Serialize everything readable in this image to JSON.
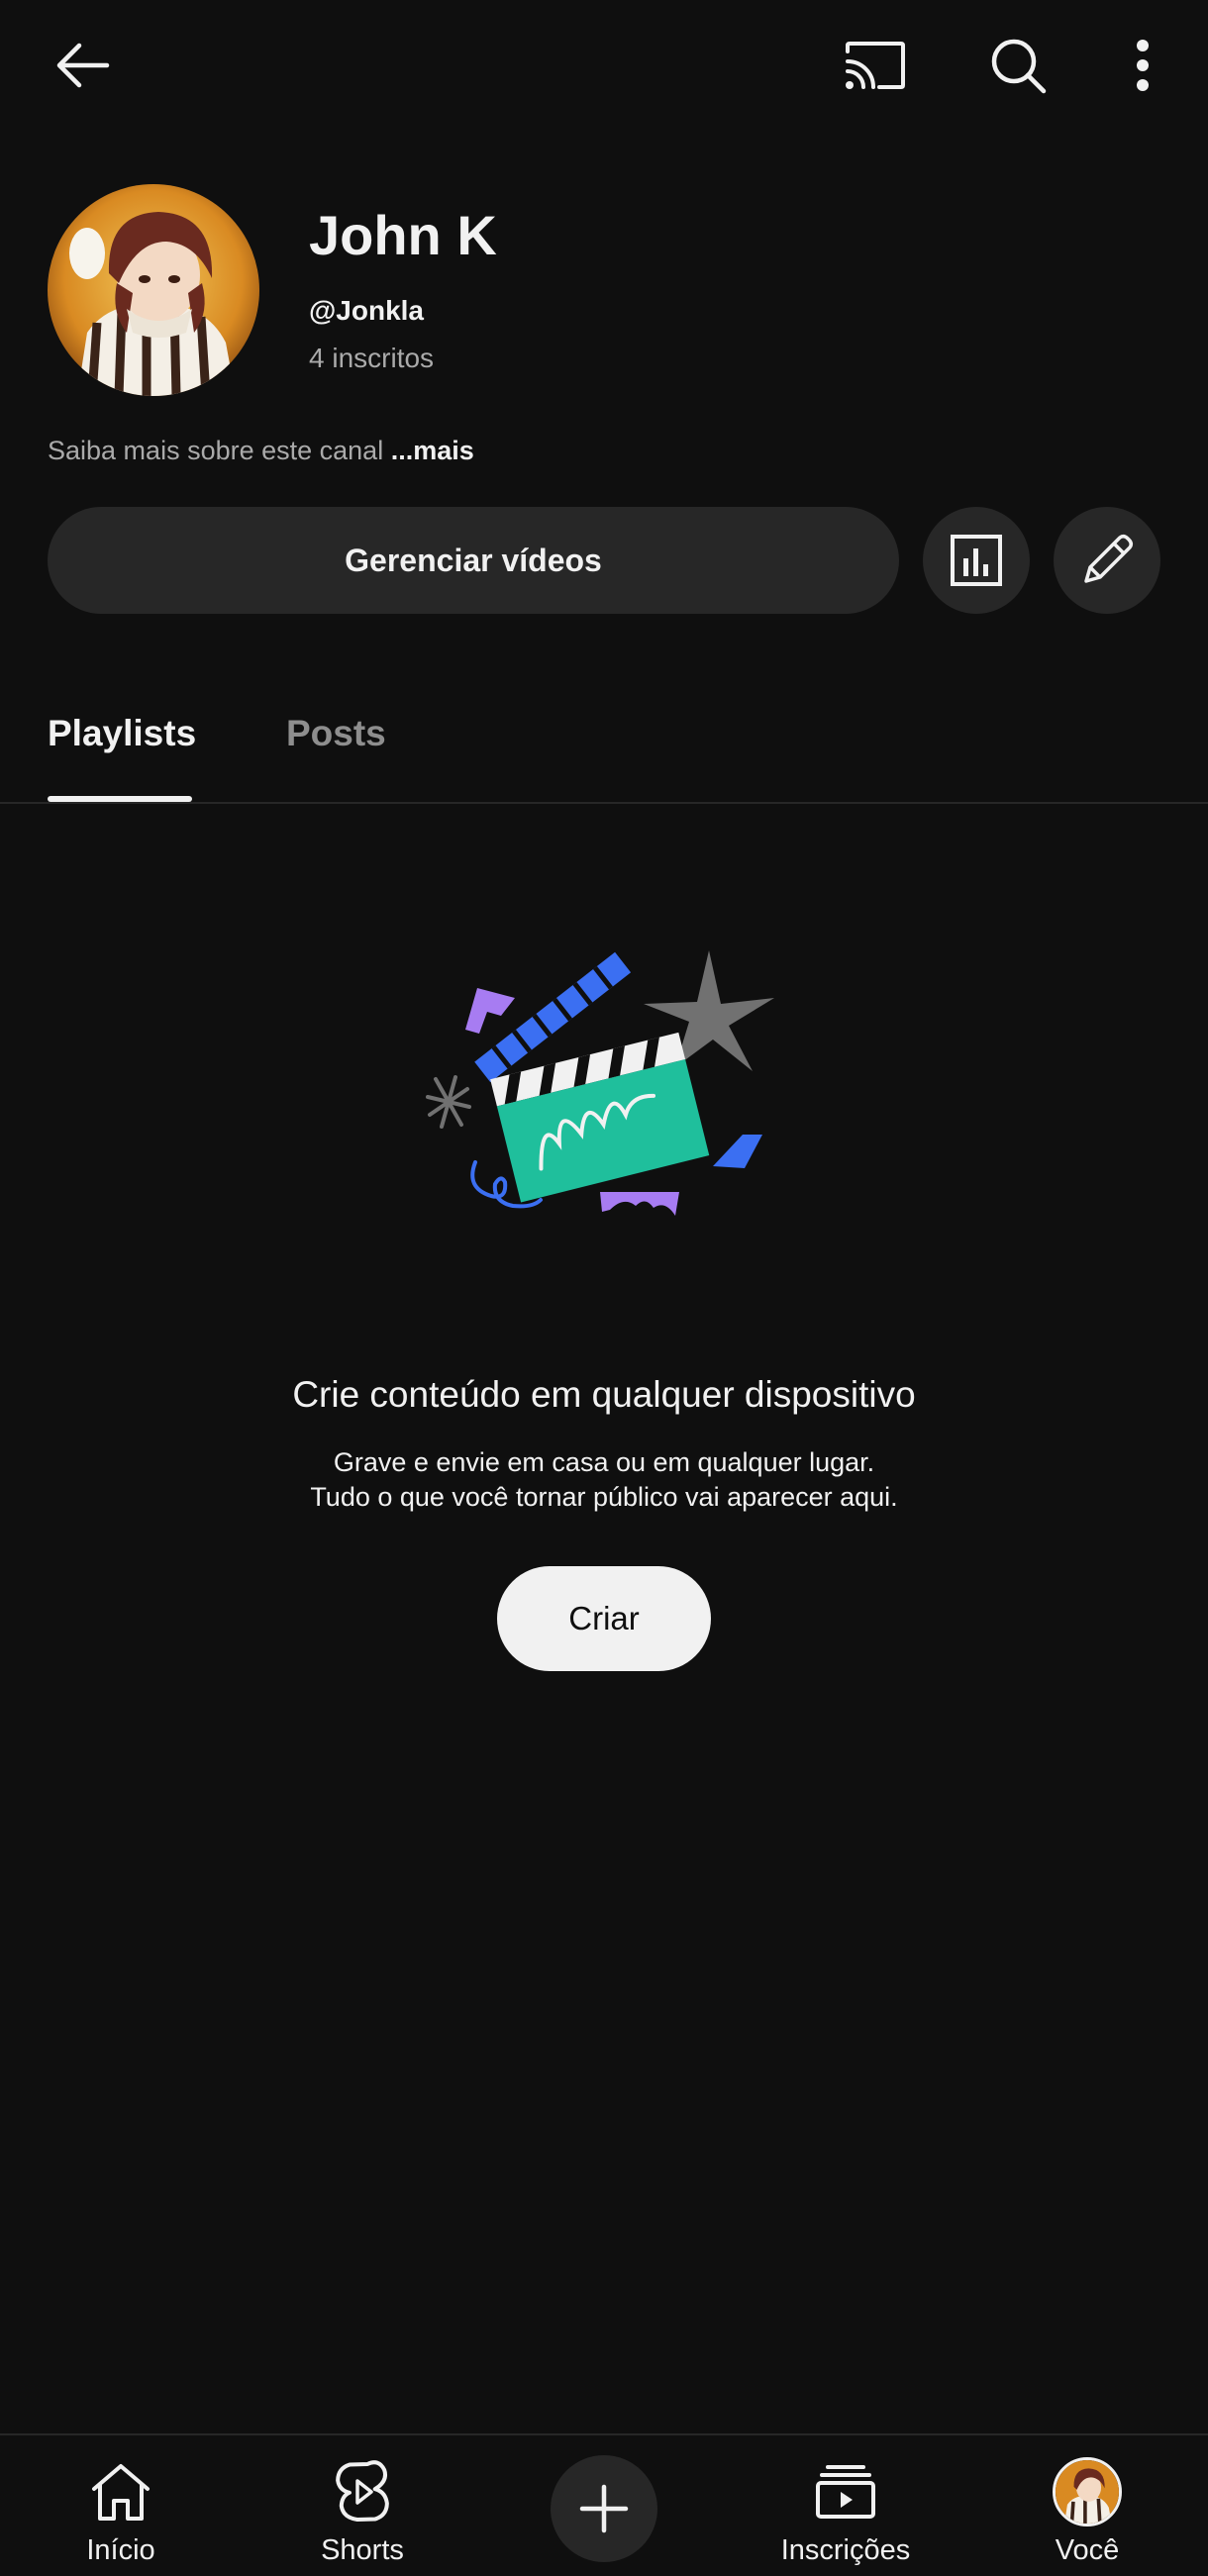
{
  "topbar": {
    "back_icon": "arrow-left-icon",
    "cast_icon": "cast-icon",
    "search_icon": "search-icon",
    "more_icon": "more-vert-icon"
  },
  "channel": {
    "name": "John K",
    "handle": "@Jonkla",
    "subscribers": "4 inscritos",
    "about_text": "Saiba mais sobre este canal",
    "about_more": "...mais"
  },
  "actions": {
    "manage_label": "Gerenciar vídeos",
    "analytics_icon": "analytics-icon",
    "edit_icon": "pencil-icon"
  },
  "tabs": [
    {
      "label": "Playlists",
      "active": true
    },
    {
      "label": "Posts",
      "active": false
    }
  ],
  "empty_state": {
    "title": "Crie conteúdo em qualquer dispositivo",
    "line1": "Grave e envie em casa ou em qualquer lugar.",
    "line2": "Tudo o que você tornar público vai aparecer aqui.",
    "button_label": "Criar"
  },
  "bottom_nav": {
    "items": [
      {
        "label": "Início",
        "icon": "home-icon"
      },
      {
        "label": "Shorts",
        "icon": "shorts-icon"
      },
      {
        "label": "",
        "icon": "plus-icon"
      },
      {
        "label": "Inscrições",
        "icon": "subscriptions-icon"
      },
      {
        "label": "Você",
        "icon": "avatar-icon"
      }
    ]
  },
  "colors": {
    "background": "#0f0f0f",
    "surface": "#272727",
    "text": "#f1f1f1",
    "muted": "#aaaaaa",
    "illustration_blue": "#3b6ff2",
    "illustration_green": "#1fbf9c",
    "illustration_purple": "#a77cf2",
    "illustration_gray": "#717171"
  }
}
